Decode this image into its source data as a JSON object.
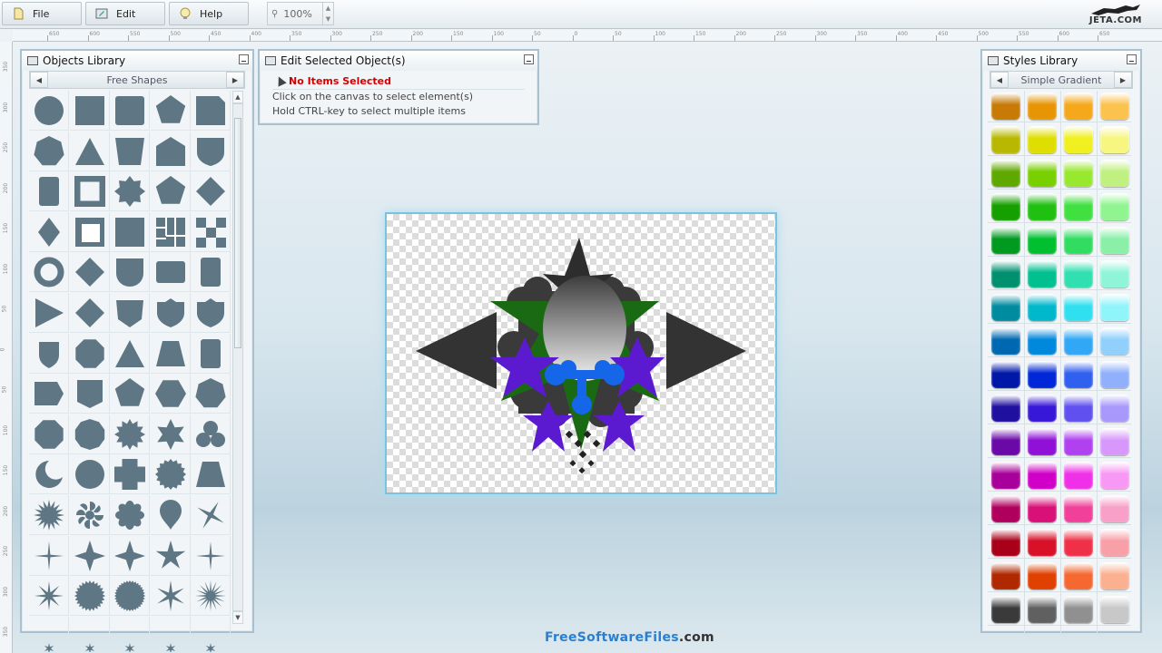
{
  "toolbar": {
    "file_label": "File",
    "edit_label": "Edit",
    "help_label": "Help",
    "zoom_value": "100%",
    "logo_text": "JETA.COM"
  },
  "hruler_labels": [
    "650",
    "600",
    "550",
    "500",
    "450",
    "400",
    "350",
    "300",
    "250",
    "200",
    "150",
    "100",
    "50",
    "0",
    "50",
    "100",
    "150",
    "200",
    "250",
    "300",
    "350",
    "400",
    "450",
    "500",
    "550",
    "600",
    "650"
  ],
  "vruler_labels": [
    "350",
    "300",
    "250",
    "200",
    "150",
    "100",
    "50",
    "0",
    "50",
    "100",
    "150",
    "200",
    "250",
    "300",
    "350"
  ],
  "objects_library": {
    "title": "Objects Library",
    "category": "Free Shapes",
    "shape_color": "#5f7784",
    "shapes": [
      "circle",
      "square",
      "rounded-square",
      "pentagon",
      "folded-square",
      "heptagon",
      "triangle",
      "trapezoid-down",
      "house-pentagon",
      "shield",
      "rounded-rect-tall",
      "hollow-square",
      "star-8",
      "pentagon",
      "diamond",
      "diamond-tall",
      "page-square",
      "square",
      "parquet",
      "checker",
      "ring",
      "diamond",
      "shield-round",
      "rounded-rect-wide",
      "rounded-rect-tall",
      "play-triangle",
      "diamond",
      "pentagon-wide",
      "badge-shield",
      "badge-shield",
      "badge-small",
      "octagon-badge",
      "triangle",
      "trapezoid",
      "rounded-rect-tall",
      "pentagon-side",
      "shield-flat",
      "pentagon",
      "hexagon",
      "heptagon",
      "octagon",
      "decagon",
      "star-12",
      "star-6",
      "trefoil",
      "crescent",
      "circle",
      "cross-round",
      "seal",
      "trapezoid",
      "burst",
      "spiral-flower",
      "flower",
      "teardrop",
      "sparkle-4",
      "sparkle-4-thin",
      "star-4",
      "star-4",
      "star-5",
      "sparkle-4-thin",
      "star-8-thin",
      "seal-24",
      "seal-32",
      "star-6-thin",
      "star-16-thin",
      "small",
      "small",
      "small",
      "small",
      "small"
    ]
  },
  "edit_panel": {
    "title": "Edit Selected Object(s)",
    "status": "No Items Selected",
    "hint1": "Click on the canvas to select element(s)",
    "hint2": "Hold CTRL-key to select multiple items"
  },
  "styles_library": {
    "title": "Styles Library",
    "category": "Simple Gradient",
    "colors": [
      "#c77a05",
      "#e89505",
      "#f5a81a",
      "#fbc24e",
      "#b8b800",
      "#dede00",
      "#f0f020",
      "#f6f680",
      "#5fa800",
      "#78d000",
      "#98e830",
      "#bff080",
      "#16a000",
      "#20c010",
      "#40e040",
      "#90f590",
      "#009a20",
      "#00c030",
      "#30dd60",
      "#8af0a8",
      "#009070",
      "#00c090",
      "#30e0b0",
      "#90f5d8",
      "#008ca0",
      "#00b8cc",
      "#30e0f0",
      "#90f5fb",
      "#0068b0",
      "#0088dd",
      "#30a8f5",
      "#90d0fb",
      "#0018a8",
      "#0028d8",
      "#3060f0",
      "#90b0fb",
      "#2010a0",
      "#3818d8",
      "#6050f0",
      "#a898fb",
      "#6a08a8",
      "#9010d8",
      "#b040f0",
      "#d898fb",
      "#a8009a",
      "#d000c8",
      "#f030e8",
      "#f898f5",
      "#b0005e",
      "#d81078",
      "#f0409a",
      "#f8a0c8",
      "#a80018",
      "#d81028",
      "#f03048",
      "#f8a0a8",
      "#b02800",
      "#e04000",
      "#f56830",
      "#fbb090",
      "#3a3a3a",
      "#606060",
      "#909090",
      "#c8c8c8"
    ]
  },
  "footer": {
    "part1": "FreeSoftwareFiles",
    "part2": ".com",
    "color1": "#2a7fd0",
    "color2": "#333333"
  }
}
